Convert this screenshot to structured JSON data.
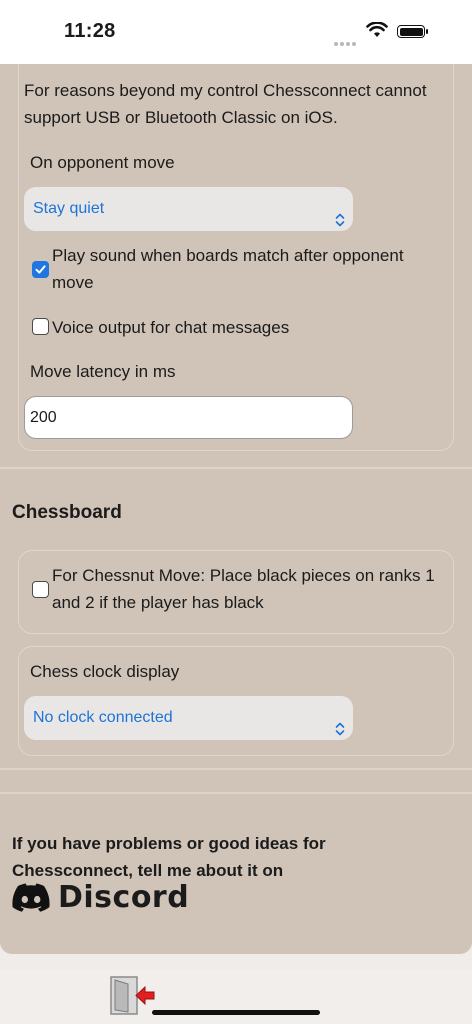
{
  "status_bar": {
    "time": "11:28"
  },
  "connection": {
    "notice": "For reasons beyond my control Chessconnect cannot support USB or Bluetooth Classic on iOS.",
    "opponent_move_label": "On opponent move",
    "opponent_move_value": "Stay quiet",
    "play_sound_label": "Play sound when boards match after opponent move",
    "play_sound_checked": true,
    "voice_output_label": "Voice output for chat messages",
    "voice_output_checked": false,
    "latency_label": "Move latency in ms",
    "latency_value": "200"
  },
  "chessboard": {
    "heading": "Chessboard",
    "chessnut_label": "For Chessnut Move: Place black pieces on ranks 1 and 2 if the player has black",
    "chessnut_checked": false,
    "clock_label": "Chess clock display",
    "clock_value": "No clock connected"
  },
  "footer": {
    "help_text": "If you have problems or good ideas for Chessconnect, tell me about it on",
    "discord_label": "Discord"
  },
  "colors": {
    "panel": "#d0c4b8",
    "accent": "#1f76e0",
    "select_text": "#1e73d6"
  },
  "icons": [
    "signal-dots-icon",
    "wifi-icon",
    "battery-icon",
    "chevron-updown-icon",
    "checkmark-icon",
    "discord-logo-icon",
    "exit-door-icon"
  ]
}
